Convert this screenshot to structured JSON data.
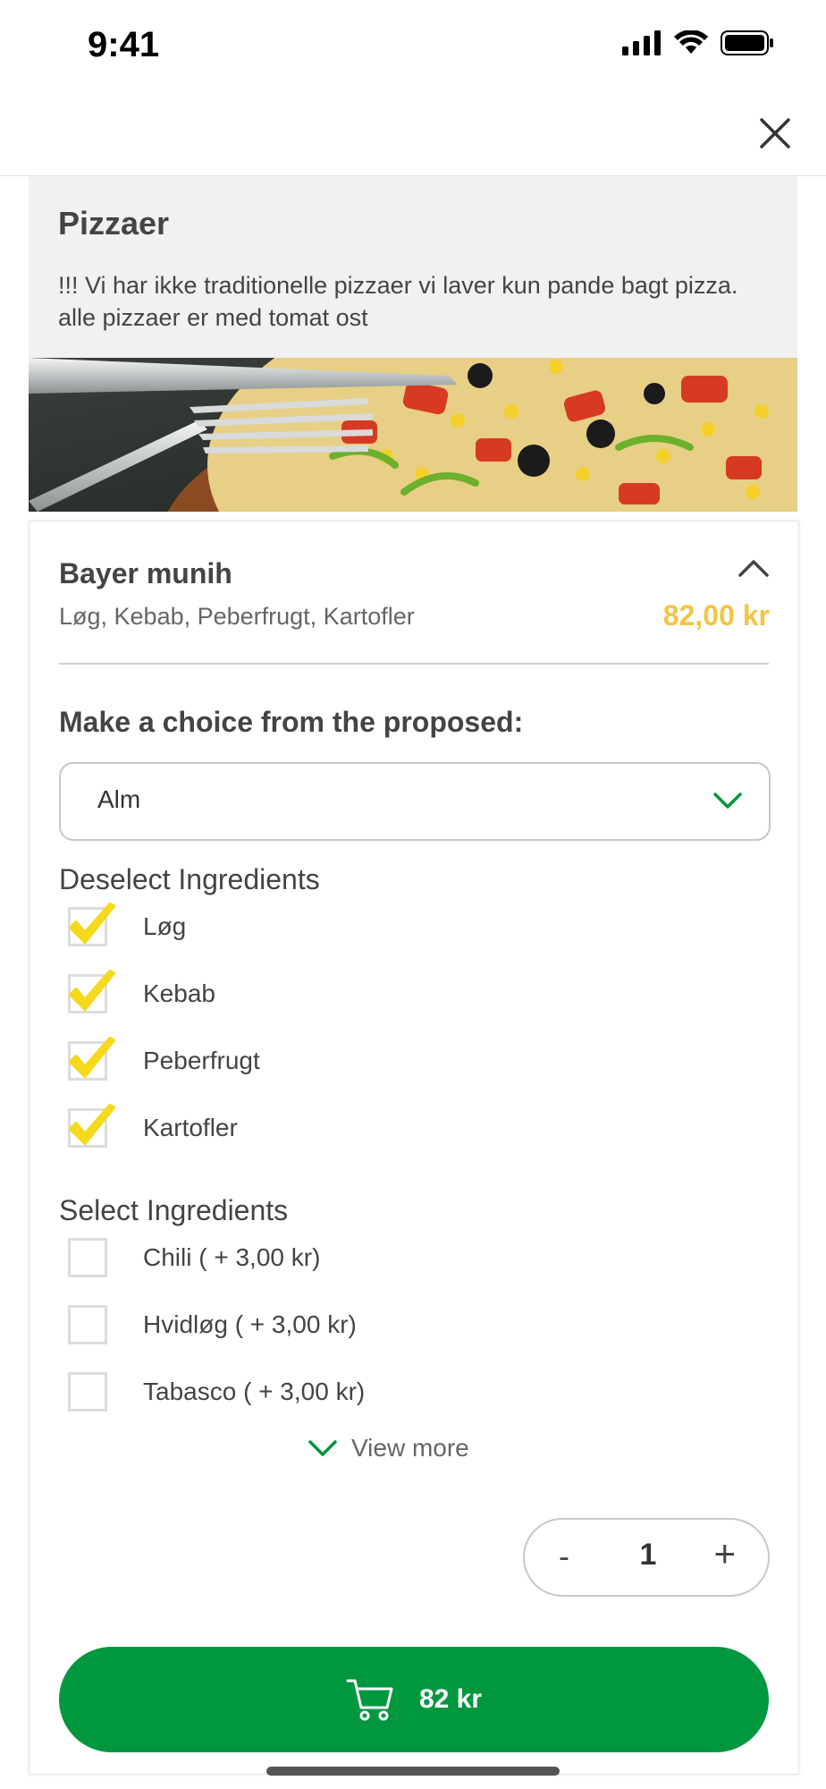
{
  "status_bar": {
    "time": "9:41"
  },
  "category": {
    "title": "Pizzaer",
    "description": "!!! Vi har ikke traditionelle pizzaer vi laver kun pande bagt pizza. alle pizzaer er med tomat ost"
  },
  "item": {
    "name": "Bayer munih",
    "ingredients": "Løg, Kebab, Peberfrugt, Kartofler",
    "price": "82,00 kr"
  },
  "choice": {
    "label": "Make a choice from the proposed:",
    "selected": "Alm"
  },
  "deselect": {
    "title": "Deselect Ingredients",
    "items": [
      {
        "label": "Løg",
        "checked": true
      },
      {
        "label": "Kebab",
        "checked": true
      },
      {
        "label": "Peberfrugt",
        "checked": true
      },
      {
        "label": "Kartofler",
        "checked": true
      }
    ]
  },
  "select": {
    "title": "Select Ingredients",
    "items": [
      {
        "label": "Chili ( + 3,00 kr)",
        "checked": false
      },
      {
        "label": "Hvidløg ( + 3,00 kr)",
        "checked": false
      },
      {
        "label": "Tabasco ( + 3,00 kr)",
        "checked": false
      }
    ],
    "view_more": "View more"
  },
  "quantity": {
    "minus": "-",
    "value": "1",
    "plus": "+"
  },
  "cart_button": {
    "label": "82 kr"
  },
  "colors": {
    "accent_green": "#00973f",
    "price_yellow": "#f4c542",
    "check_yellow": "#f5d91c"
  },
  "icons": {
    "close": "close-icon",
    "collapse": "chevron-up-icon",
    "dropdown": "chevron-down-icon",
    "check": "checkmark-icon",
    "cart": "cart-icon"
  }
}
